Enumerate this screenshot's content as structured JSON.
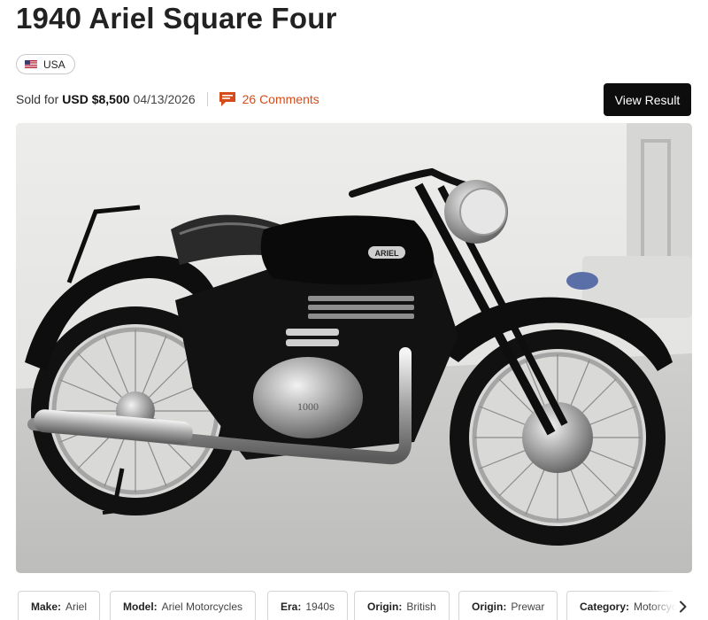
{
  "listing": {
    "title": "1940 Ariel Square Four",
    "country": "USA",
    "sold_prefix": "Sold for",
    "price": "USD $8,500",
    "date": "04/13/2026",
    "comments_label": "26 Comments",
    "view_result_label": "View Result",
    "image_alt": "1940 Ariel Square Four motorcycle",
    "tank_badge": "ARIEL",
    "engine_badge": "1000"
  },
  "specs": [
    {
      "key": "Make:",
      "value": "Ariel"
    },
    {
      "key": "Model:",
      "value": "Ariel Motorcycles"
    },
    {
      "key": "Era:",
      "value": "1940s"
    },
    {
      "key": "Origin:",
      "value": "British"
    },
    {
      "key": "Origin:",
      "value": "Prewar"
    },
    {
      "key": "Category:",
      "value": "Motorcycles"
    }
  ],
  "icons": {
    "flag": "us-flag-icon",
    "comments": "comment-bubble-icon",
    "next": "chevron-right-icon"
  },
  "colors": {
    "accent": "#d64b1a",
    "button_bg": "#0d0d0d"
  }
}
